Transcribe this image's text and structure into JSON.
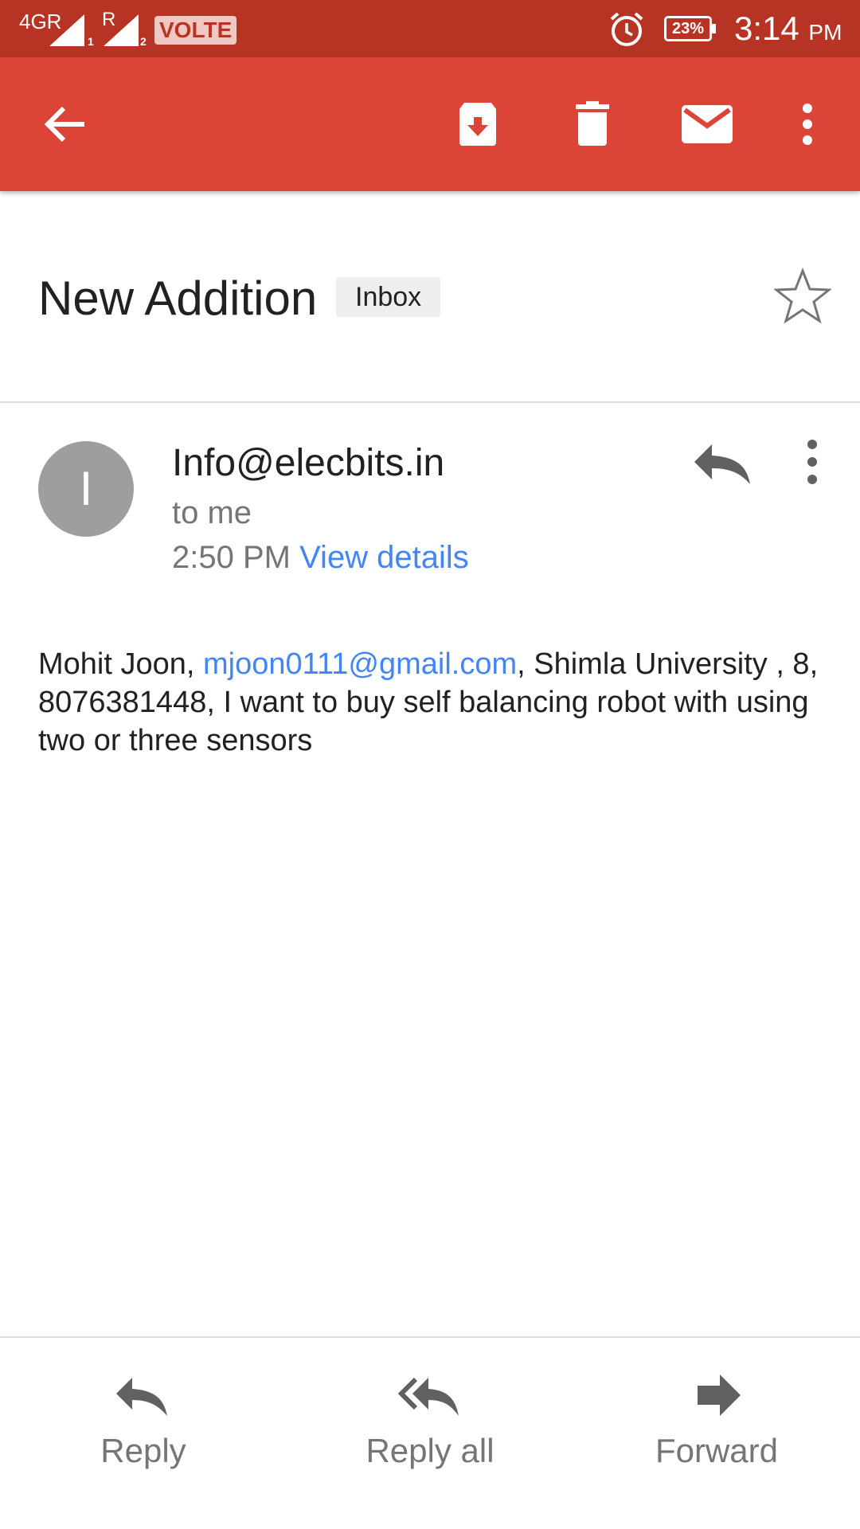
{
  "status_bar": {
    "network": "4GR",
    "sim1": "1",
    "sim2": "2",
    "roaming": "R",
    "volte": "VOLTE",
    "battery": "23%",
    "time": "3:14",
    "ampm": "PM"
  },
  "toolbar": {
    "icons": [
      "back-arrow-icon",
      "archive-icon",
      "delete-icon",
      "mark-unread-icon",
      "more-vert-icon"
    ]
  },
  "message": {
    "subject": "New Addition",
    "label": "Inbox",
    "avatar_letter": "I",
    "sender": "Info@elecbits.in",
    "recipient": "to me",
    "time": "2:50 PM",
    "view_details": "View details",
    "body_pre": "Mohit Joon,  ",
    "body_email": "mjoon0111@gmail.com",
    "body_post": ", Shimla University , 8, 8076381448, I want to buy self balancing robot with using two or three sensors"
  },
  "actions": {
    "reply": "Reply",
    "reply_all": "Reply all",
    "forward": "Forward"
  },
  "colors": {
    "status_bar": "#b73323",
    "toolbar": "#db4437",
    "link": "#4285f4",
    "avatar": "#9e9e9e"
  }
}
